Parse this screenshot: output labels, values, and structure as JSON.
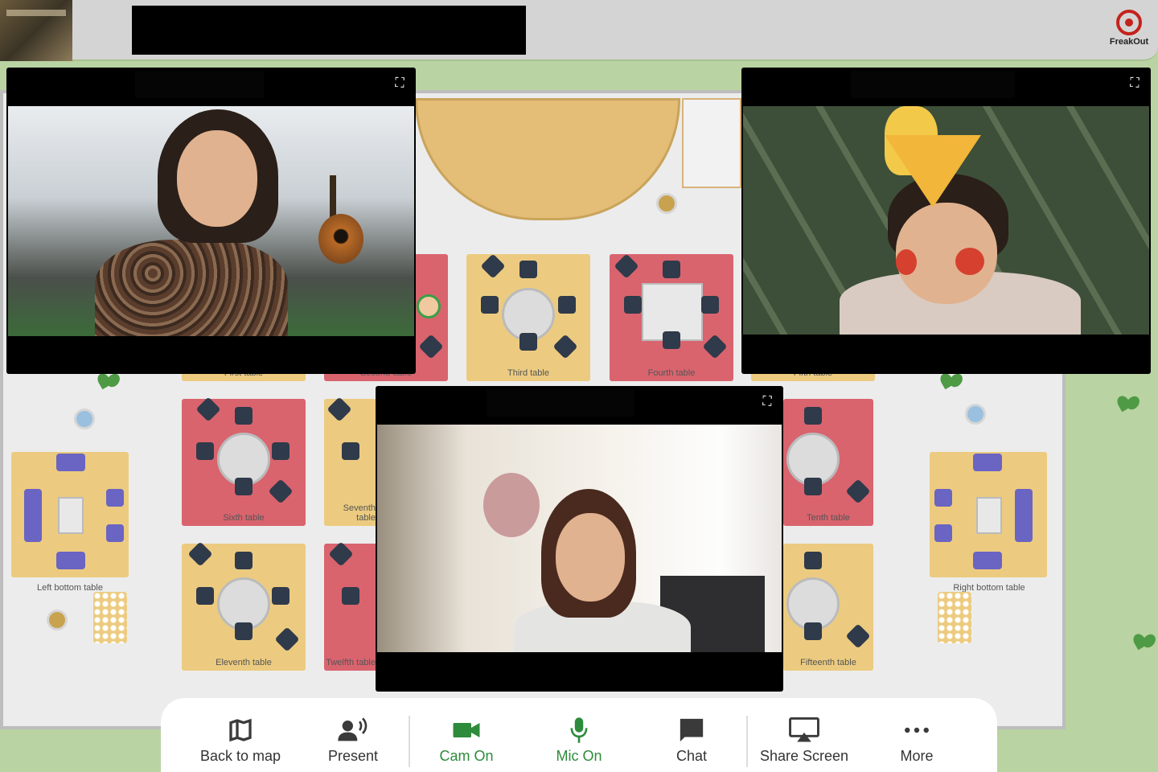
{
  "map": {
    "tables": [
      {
        "label": "First table"
      },
      {
        "label": "Second table"
      },
      {
        "label": "Third table"
      },
      {
        "label": "Fourth table"
      },
      {
        "label": "Fifth table"
      },
      {
        "label": "Sixth table"
      },
      {
        "label": "Seventh table"
      },
      {
        "label": "Tenth table"
      },
      {
        "label": "Eleventh table"
      },
      {
        "label": "Twelfth table"
      },
      {
        "label": "Fifteenth table"
      }
    ],
    "left_bottom_table": "Left bottom table",
    "right_bottom_table": "Right bottom table"
  },
  "header": {
    "logo_text": "FreakOut"
  },
  "videos": {
    "expand_icon": "⛶"
  },
  "toolbar": {
    "items": [
      {
        "label": "Back to map",
        "icon": "map-icon"
      },
      {
        "label": "Present",
        "icon": "present-icon"
      },
      {
        "label": "Cam On",
        "icon": "camera-icon",
        "color": "#2e8b3b"
      },
      {
        "label": "Mic On",
        "icon": "mic-icon",
        "color": "#2e8b3b"
      },
      {
        "label": "Chat",
        "icon": "chat-icon"
      },
      {
        "label": "Share Screen",
        "icon": "share-screen-icon"
      },
      {
        "label": "More",
        "icon": "more-icon"
      }
    ]
  }
}
